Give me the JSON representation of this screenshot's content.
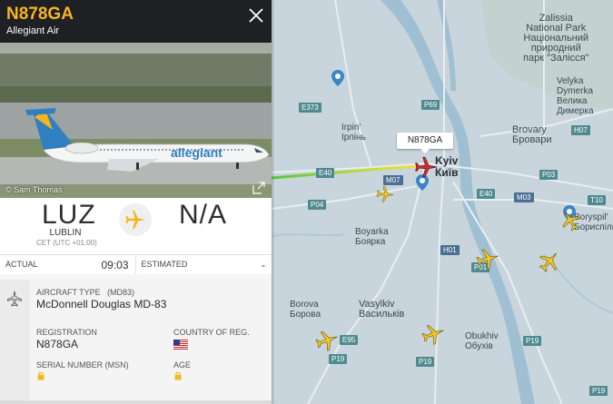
{
  "flight": {
    "callsign": "N878GA",
    "airline": "Allegiant Air",
    "photo_credit": "© Sam Thomas",
    "photo_livery_text": "allegiant"
  },
  "route": {
    "origin_code": "LUZ",
    "origin_city": "LUBLIN",
    "origin_tz": "CET (UTC +01:00)",
    "dest_code": "N/A"
  },
  "times": {
    "actual_label": "ACTUAL",
    "actual_value": "09:03",
    "estimated_label": "ESTIMATED",
    "estimated_value": "-"
  },
  "aircraft": {
    "type_label": "AIRCRAFT TYPE",
    "type_code": "(MD83)",
    "type_name": "McDonnell Douglas MD-83",
    "registration_label": "REGISTRATION",
    "registration_value": "N878GA",
    "country_label": "COUNTRY OF REG.",
    "serial_label": "SERIAL NUMBER (MSN)",
    "age_label": "AGE"
  },
  "map": {
    "callout": "N878GA",
    "places": [
      {
        "key": "zalissia",
        "text": "Zalissia\nNational Park\nНаціональний\nприродний\nпарк \"Залісся\""
      },
      {
        "key": "velyka",
        "text": "Velyka\nDymerka\nВелика\nДимерка"
      },
      {
        "key": "irpin",
        "text": "Irpin'\nІрпінь"
      },
      {
        "key": "kyiv",
        "text": "Kyiv\nКиїв"
      },
      {
        "key": "brovary",
        "text": "Brovary\nБровари"
      },
      {
        "key": "boryspil",
        "text": "Boryspil'\nБориспіль"
      },
      {
        "key": "boyarka",
        "text": "Boyarka\nБоярка"
      },
      {
        "key": "borova",
        "text": "Borova\nБорова"
      },
      {
        "key": "vasylkiv",
        "text": "Vasylkiv\nВасильків"
      },
      {
        "key": "obukhiv",
        "text": "Obukhiv\nОбухів"
      }
    ],
    "roads": [
      "E373",
      "P69",
      "E40",
      "H07",
      "P03",
      "M07",
      "P04",
      "E40",
      "M03",
      "T10",
      "H01",
      "P01",
      "E95",
      "P19",
      "P19",
      "P19",
      "P19"
    ],
    "colors": {
      "water": "#9fc0d3",
      "land": "#c9d5dc",
      "trail_start": "#55c63a",
      "trail_end": "#f4e23a",
      "selected_plane": "#d0312d",
      "plane": "#f6c928"
    }
  },
  "colors": {
    "accent": "#f6b61f",
    "header_bg": "#1e2024"
  }
}
